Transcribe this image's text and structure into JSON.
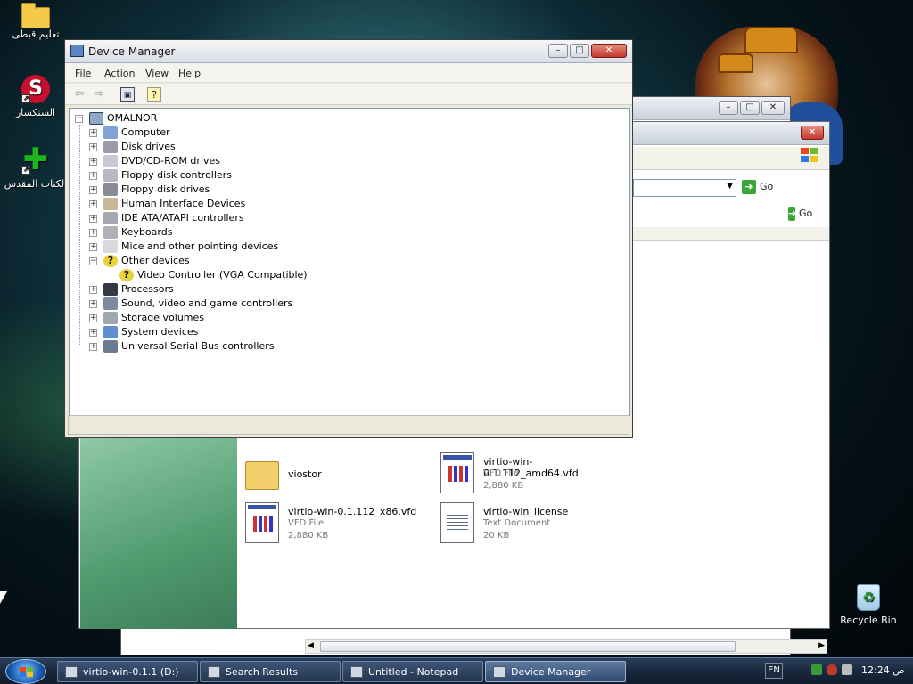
{
  "desktop": {
    "icons": [
      {
        "label": "تعليم قبطى",
        "icon": "folder-icon"
      },
      {
        "label": "السنكسار",
        "icon": "synaxarium-app-icon"
      },
      {
        "label": "الكتاب المقدس",
        "icon": "bible-app-icon"
      },
      {
        "label": "Recycle Bin",
        "icon": "recycle-bin-icon"
      }
    ]
  },
  "explorer": {
    "go_label": "Go",
    "go_label2": "Go",
    "files": [
      {
        "name": "viostor",
        "type": "",
        "size": "",
        "icon": "folder-icon"
      },
      {
        "name": "virtio-win-0.1.112_amd64.vfd",
        "type": "VFD File",
        "size": "2,880 KB",
        "icon": "vfd-file-icon"
      },
      {
        "name": "virtio-win-0.1.112_x86.vfd",
        "type": "VFD File",
        "size": "2,880 KB",
        "icon": "vfd-file-icon"
      },
      {
        "name": "virtio-win_license",
        "type": "Text Document",
        "size": "20 KB",
        "icon": "text-document-icon"
      }
    ]
  },
  "device_manager": {
    "title": "Device Manager",
    "menu": [
      "File",
      "Action",
      "View",
      "Help"
    ],
    "root": "OMALNOR",
    "nodes": [
      {
        "label": "Computer",
        "icon": "computer-icon",
        "expander": "+"
      },
      {
        "label": "Disk drives",
        "icon": "disk-drive-icon",
        "expander": "+"
      },
      {
        "label": "DVD/CD-ROM drives",
        "icon": "dvd-drive-icon",
        "expander": "+"
      },
      {
        "label": "Floppy disk controllers",
        "icon": "floppy-controller-icon",
        "expander": "+"
      },
      {
        "label": "Floppy disk drives",
        "icon": "floppy-drive-icon",
        "expander": "+"
      },
      {
        "label": "Human Interface Devices",
        "icon": "hid-icon",
        "expander": "+"
      },
      {
        "label": "IDE ATA/ATAPI controllers",
        "icon": "ide-controller-icon",
        "expander": "+"
      },
      {
        "label": "Keyboards",
        "icon": "keyboard-icon",
        "expander": "+"
      },
      {
        "label": "Mice and other pointing devices",
        "icon": "mouse-icon",
        "expander": "+"
      },
      {
        "label": "Other devices",
        "icon": "unknown-device-icon",
        "expander": "-"
      },
      {
        "label": "Video Controller (VGA Compatible)",
        "icon": "unknown-device-warning-icon",
        "expander": ""
      },
      {
        "label": "Processors",
        "icon": "processor-icon",
        "expander": "+"
      },
      {
        "label": "Sound, video and game controllers",
        "icon": "sound-icon",
        "expander": "+"
      },
      {
        "label": "Storage volumes",
        "icon": "storage-volume-icon",
        "expander": "+"
      },
      {
        "label": "System devices",
        "icon": "system-device-icon",
        "expander": "+"
      },
      {
        "label": "Universal Serial Bus controllers",
        "icon": "usb-icon",
        "expander": "+"
      }
    ]
  },
  "taskbar": {
    "tasks": [
      {
        "label": "virtio-win-0.1.1 (D:)",
        "icon": "drive-icon"
      },
      {
        "label": "Search Results",
        "icon": "search-results-icon"
      },
      {
        "label": "Untitled - Notepad",
        "icon": "notepad-icon"
      },
      {
        "label": "Device Manager",
        "icon": "device-manager-icon"
      }
    ],
    "language": "EN",
    "clock": "12:24 ص"
  }
}
